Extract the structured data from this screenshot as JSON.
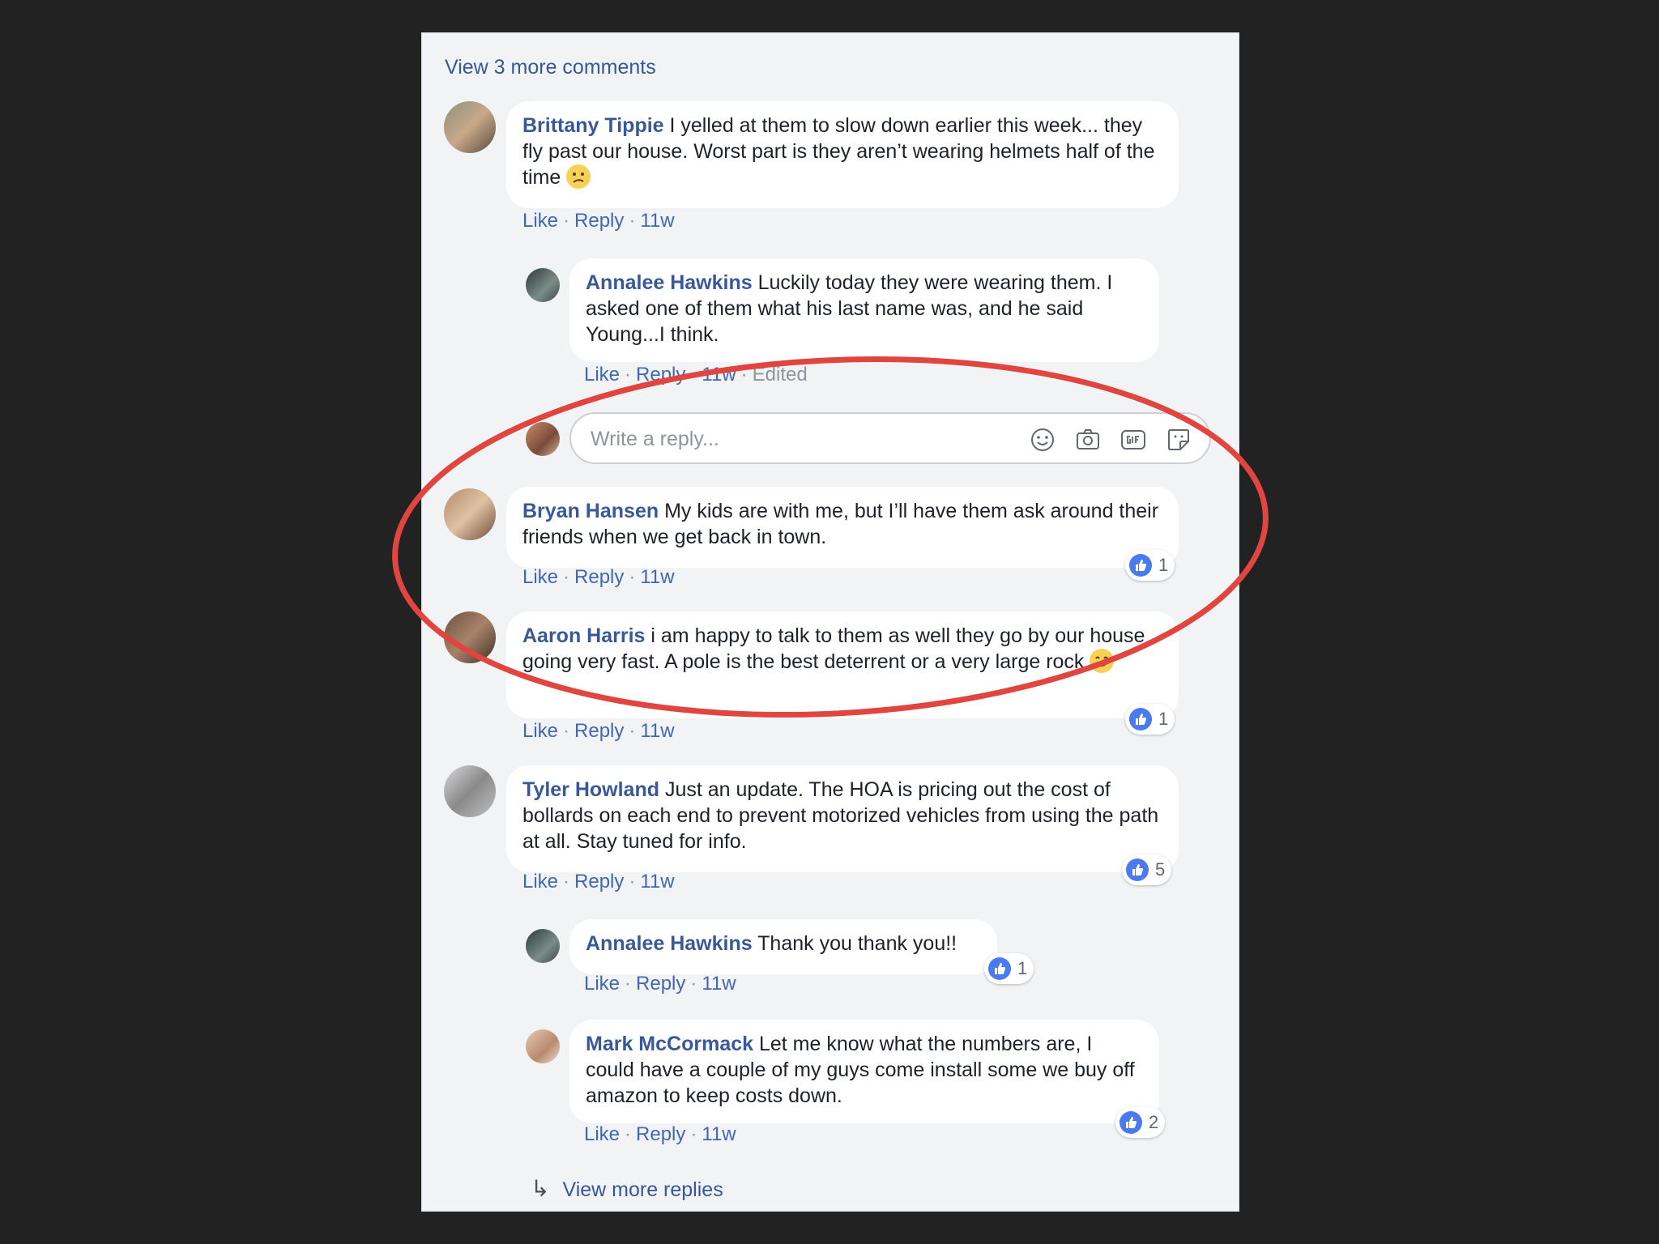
{
  "thread": {
    "view_more_comments": "View 3 more comments",
    "view_more_replies": "View more replies",
    "reply_placeholder": "Write a reply...",
    "action_like": "Like",
    "action_reply": "Reply",
    "separator": "·",
    "comments": [
      {
        "author": "Brittany Tippie",
        "text": "I yelled at them to slow down earlier this week... they fly past our house. Worst part is they aren’t wearing helmets half of the time",
        "time": "11w",
        "emoji": "confused-face"
      },
      {
        "author": "Annalee Hawkins",
        "text": "Luckily today they were wearing them. I asked one of them what his last name was, and he said Young...I think.",
        "time": "11w",
        "edited": "Edited"
      },
      {
        "author": "Bryan Hansen",
        "text": "My kids are with me, but I’ll have them ask around their friends when we get back in town.",
        "time": "11w",
        "likes": "1"
      },
      {
        "author": "Aaron Harris",
        "text": "i am happy to talk to them as well they go by our house going very fast. A pole is the best deterrent or a very large rock",
        "time": "11w",
        "likes": "1",
        "emoji": "smiling-face"
      },
      {
        "author": "Tyler Howland",
        "text": "Just an update. The HOA is pricing out the cost of bollards on each end to prevent motorized vehicles from using the path at all. Stay tuned for info.",
        "time": "11w",
        "likes": "5"
      },
      {
        "author": "Annalee Hawkins",
        "text": "Thank you thank you!!",
        "time": "11w",
        "likes": "1"
      },
      {
        "author": "Mark McCormack",
        "text": "Let me know what the numbers are, I could have a couple of my guys come install some we buy off amazon to keep costs down.",
        "time": "11w",
        "likes": "2"
      }
    ]
  },
  "colors": {
    "background": "#222222",
    "panel": "#f2f3f5",
    "author": "#385898",
    "link": "#4267b2",
    "annotation": "#e0453f",
    "like_badge": "#4a7af0"
  },
  "icons": [
    "emoji-icon",
    "camera-icon",
    "gif-icon",
    "sticker-icon",
    "like-thumb-icon",
    "reply-arrow-icon"
  ]
}
